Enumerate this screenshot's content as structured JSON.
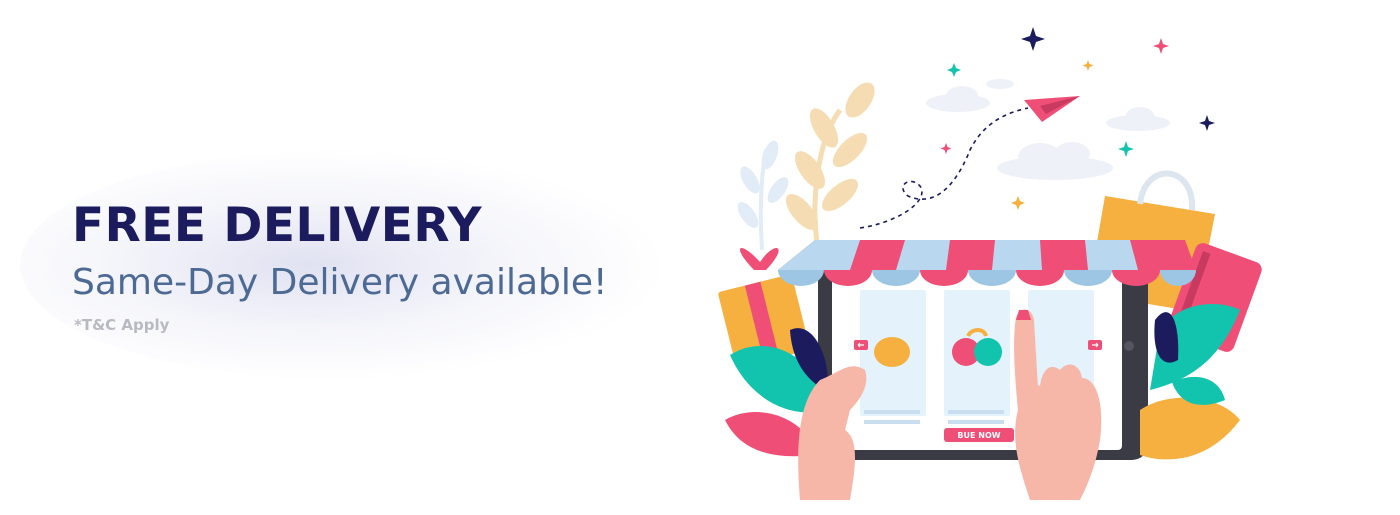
{
  "banner": {
    "headline": "FREE DELIVERY",
    "subheadline": "Same-Day Delivery available!",
    "terms": "*T&C Apply"
  },
  "illustration": {
    "buy_button_label": "BUE NOW",
    "icons": [
      "paper-plane-icon",
      "shopping-bag-icon",
      "gift-box-icon",
      "credit-card-icon",
      "tablet-icon",
      "awning-icon",
      "hand-icon",
      "leaf-icon",
      "sparkle-icon",
      "cloud-icon"
    ]
  },
  "colors": {
    "headline": "#1b1b5e",
    "subheadline": "#4d6a94",
    "terms": "#b9b9c1",
    "accent_pink": "#ef4f76",
    "accent_blue": "#9cc6e4",
    "accent_teal": "#12c3ad",
    "accent_orange": "#f5b040"
  }
}
